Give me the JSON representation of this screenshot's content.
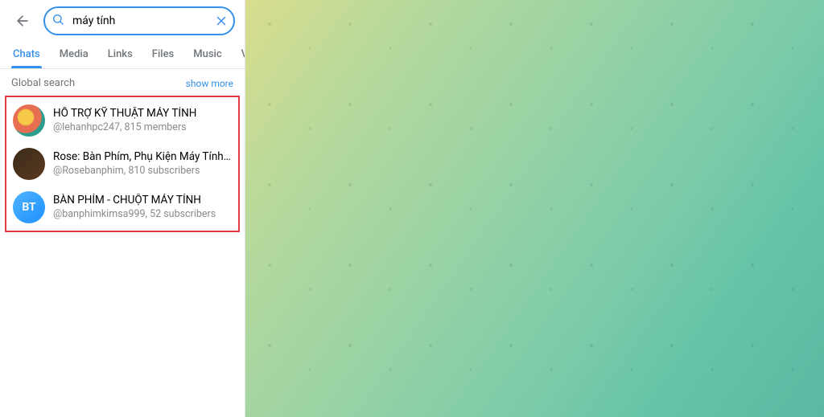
{
  "search": {
    "value": "máy tính",
    "placeholder": "Search"
  },
  "tabs": {
    "items": [
      "Chats",
      "Media",
      "Links",
      "Files",
      "Music",
      "Voice"
    ],
    "activeIndex": 0
  },
  "section": {
    "title": "Global search",
    "showMore": "show more"
  },
  "results": [
    {
      "title": "HỖ TRỢ KỸ THUẬT MÁY TÍNH",
      "sub": "@lehanhpc247, 815 members",
      "avatarText": ""
    },
    {
      "title": "Rose: Bàn Phím, Phụ Kiện Máy Tính , Đ...",
      "sub": "@Rosebanphim, 810 subscribers",
      "avatarText": ""
    },
    {
      "title": "BÀN PHÍM - CHUỘT MÁY TÍNH",
      "sub": "@banphimkimsa999, 52 subscribers",
      "avatarText": "BT"
    }
  ]
}
